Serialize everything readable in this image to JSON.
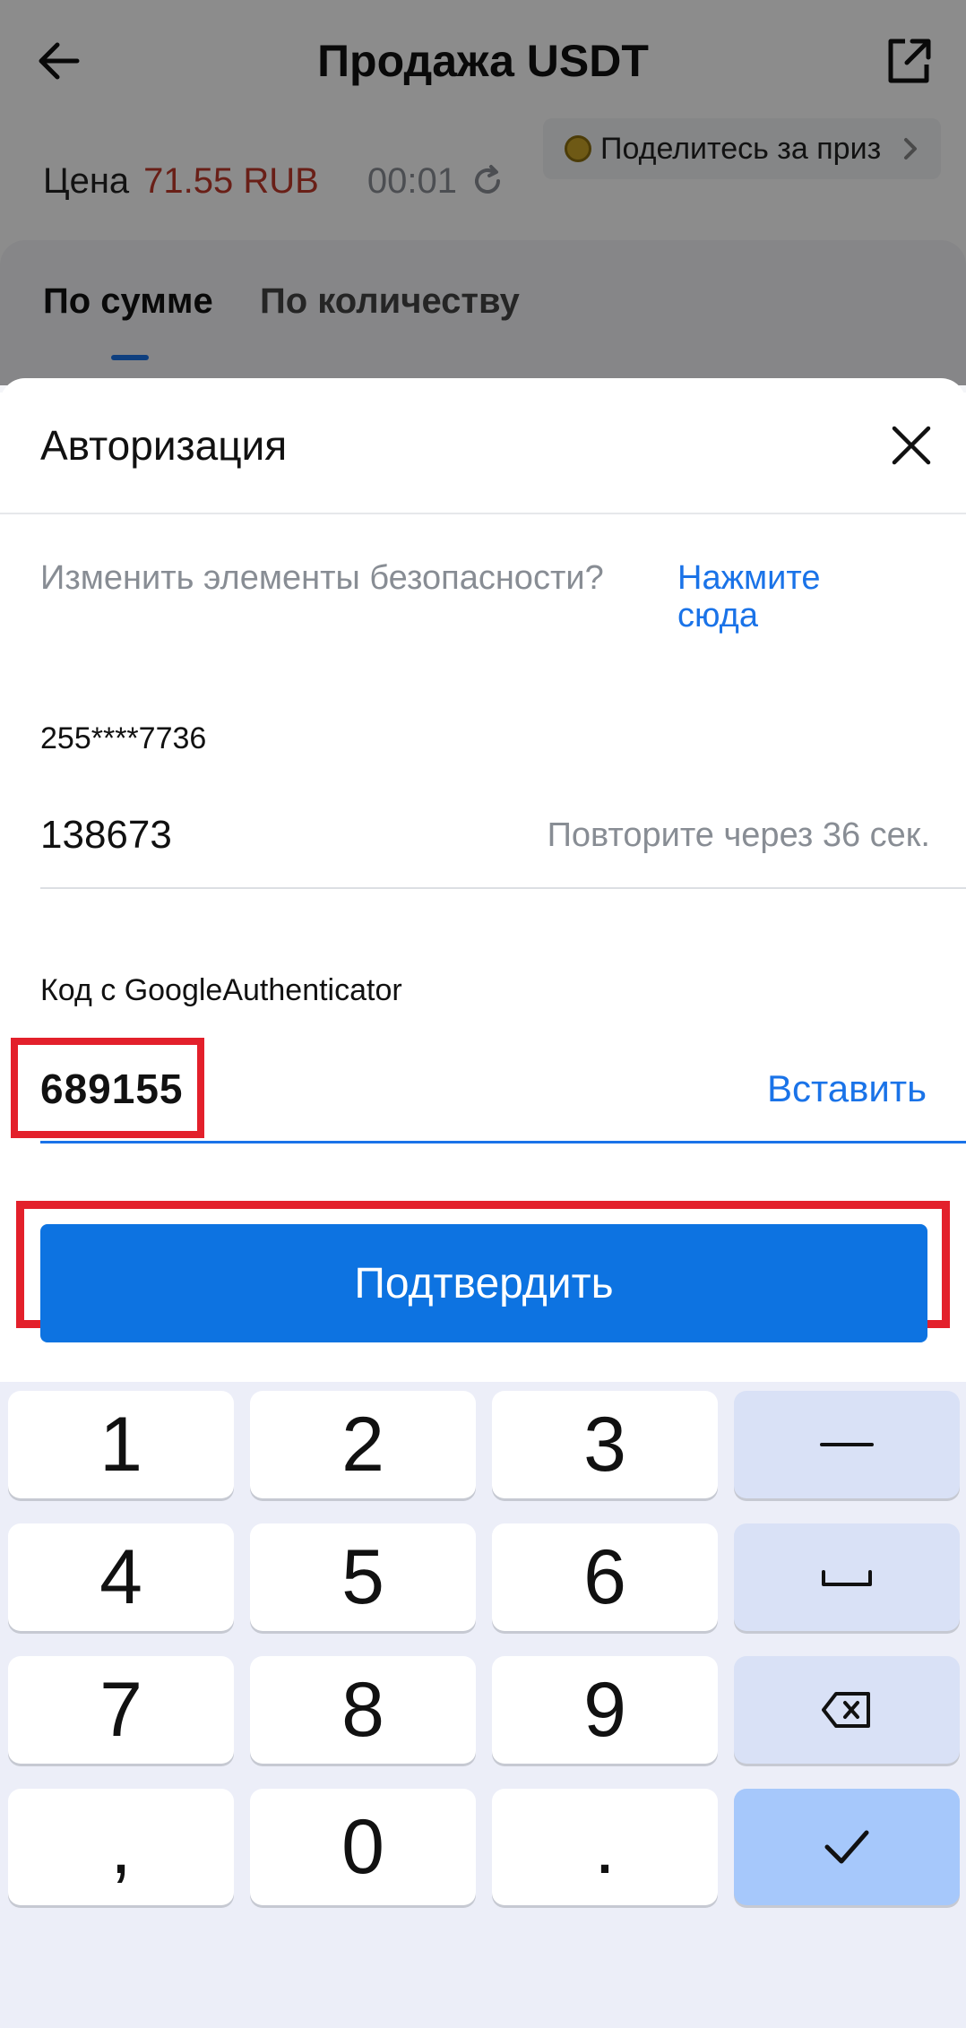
{
  "header": {
    "title": "Продажа USDT",
    "promo_text": "Поделитесь за приз"
  },
  "price": {
    "label": "Цена",
    "value": "71.55 RUB",
    "timer": "00:01"
  },
  "tabs": [
    {
      "label": "По сумме",
      "active": true
    },
    {
      "label": "По количеству",
      "active": false
    }
  ],
  "sheet": {
    "title": "Авторизация",
    "security_question": "Изменить элементы безопасности?",
    "security_link": "Нажмите сюда",
    "phone_label": "255****7736",
    "sms_code": "138673",
    "resend_text": "Повторите через 36 сек.",
    "ga_label": "Код с GoogleAuthenticator",
    "ga_code": "689155",
    "paste_label": "Вставить",
    "confirm_label": "Подтвердить"
  },
  "keypad": {
    "digits": [
      "1",
      "2",
      "3",
      "4",
      "5",
      "6",
      "7",
      "8",
      "9",
      ",",
      "0",
      "."
    ],
    "fn_keys": [
      "minus-key",
      "space-key",
      "backspace-key",
      "done-key"
    ]
  },
  "colors": {
    "accent": "#0d73e1",
    "price": "#c0392b",
    "highlight": "#e3202b"
  }
}
